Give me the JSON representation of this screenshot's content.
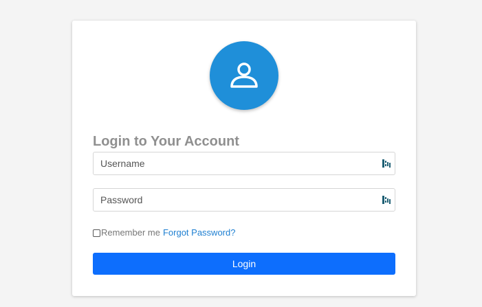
{
  "login": {
    "title": "Login to Your Account",
    "avatar_icon": "user-icon",
    "username": {
      "placeholder": "Username",
      "value": "",
      "extension_icon": "password-manager-icon"
    },
    "password": {
      "placeholder": "Password",
      "value": "",
      "extension_icon": "password-manager-icon"
    },
    "remember_label": "Remember me",
    "remember_checked": false,
    "forgot_label": "Forgot Password?",
    "submit_label": "Login"
  },
  "colors": {
    "page_background": "#f4f4f4",
    "avatar": "#1f8fd9",
    "title": "#8f8f8f",
    "link": "#1e7fd1",
    "button": "#0d6efd",
    "extension_icon": "#1e5f74"
  }
}
